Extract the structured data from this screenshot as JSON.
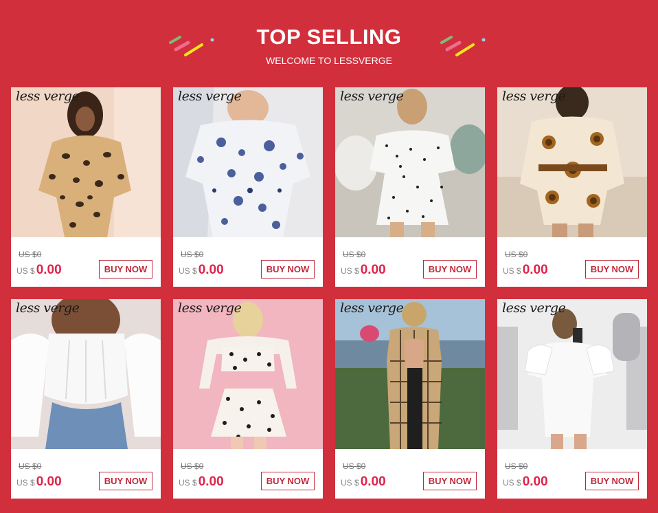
{
  "header": {
    "title": "TOP SELLING",
    "subtitle": "WELCOME TO LESSVERGE",
    "colors": {
      "background": "#d22f3c",
      "accent_pink": "#ef6b90",
      "accent_green": "#7dbb7a",
      "accent_yellow": "#f6e61a",
      "accent_blue": "#9bd0ec"
    }
  },
  "products": [
    {
      "brand": "less verge",
      "old_price": "US $0",
      "price_prefix": "US $",
      "price": "0.00",
      "buy_label": "BUY NOW",
      "image": "leopard-print-dress-photo"
    },
    {
      "brand": "less verge",
      "old_price": "US $0",
      "price_prefix": "US $",
      "price": "0.00",
      "buy_label": "BUY NOW",
      "image": "blue-floral-dress-photo"
    },
    {
      "brand": "less verge",
      "old_price": "US $0",
      "price_prefix": "US $",
      "price": "0.00",
      "buy_label": "BUY NOW",
      "image": "polka-dot-ruffle-dress-photo"
    },
    {
      "brand": "less verge",
      "old_price": "US $0",
      "price_prefix": "US $",
      "price": "0.00",
      "buy_label": "BUY NOW",
      "image": "baroque-print-romper-photo"
    },
    {
      "brand": "less verge",
      "old_price": "US $0",
      "price_prefix": "US $",
      "price": "0.00",
      "buy_label": "BUY NOW",
      "image": "white-corset-top-photo"
    },
    {
      "brand": "less verge",
      "old_price": "US $0",
      "price_prefix": "US $",
      "price": "0.00",
      "buy_label": "BUY NOW",
      "image": "polka-dot-two-piece-photo"
    },
    {
      "brand": "less verge",
      "old_price": "US $0",
      "price_prefix": "US $",
      "price": "0.00",
      "buy_label": "BUY NOW",
      "image": "plaid-backless-dress-photo"
    },
    {
      "brand": "less verge",
      "old_price": "US $0",
      "price_prefix": "US $",
      "price": "0.00",
      "buy_label": "BUY NOW",
      "image": "white-ruffle-dress-photo"
    }
  ]
}
